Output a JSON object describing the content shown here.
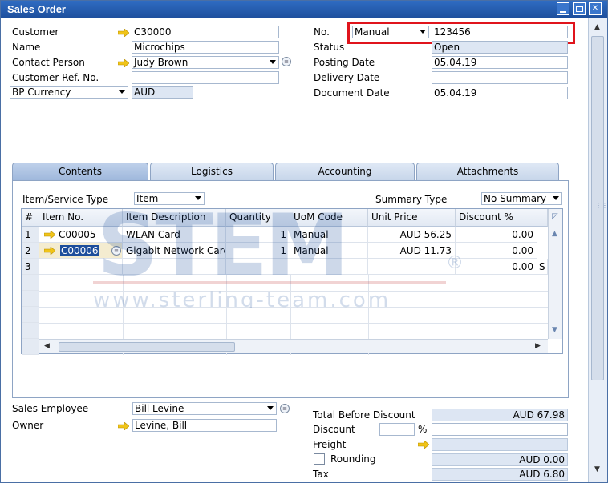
{
  "window": {
    "title": "Sales Order",
    "min_icon": "minimize-icon",
    "max_icon": "maximize-icon",
    "close_icon": "close-icon",
    "close_glyph": "✕"
  },
  "header_left": {
    "customer_label": "Customer",
    "customer_value": "C30000",
    "name_label": "Name",
    "name_value": "Microchips",
    "contact_label": "Contact Person",
    "contact_value": "Judy Brown",
    "custref_label": "Customer Ref. No.",
    "custref_value": "",
    "currency_label": "BP Currency",
    "currency_value": "AUD"
  },
  "header_right": {
    "no_label": "No.",
    "series_value": "Manual",
    "no_value": "123456",
    "status_label": "Status",
    "status_value": "Open",
    "posting_label": "Posting Date",
    "posting_value": "05.04.19",
    "delivery_label": "Delivery Date",
    "delivery_value": "",
    "docdate_label": "Document Date",
    "docdate_value": "05.04.19"
  },
  "tabs": [
    "Contents",
    "Logistics",
    "Accounting",
    "Attachments"
  ],
  "contents": {
    "itemtype_label": "Item/Service Type",
    "itemtype_value": "Item",
    "summary_label": "Summary Type",
    "summary_value": "No Summary"
  },
  "grid": {
    "headers": [
      "#",
      "Item No.",
      "Item Description",
      "Quantity",
      "UoM Code",
      "Unit Price",
      "Discount %"
    ],
    "rows": [
      {
        "n": "1",
        "item": "C00005",
        "desc": "WLAN Card",
        "qty": "1",
        "uom": "Manual",
        "price": "AUD 56.25",
        "disc": "0.00"
      },
      {
        "n": "2",
        "item": "C00006",
        "desc": "Gigabit Network Card",
        "qty": "1",
        "uom": "Manual",
        "price": "AUD 11.73",
        "disc": "0.00"
      },
      {
        "n": "3",
        "item": "",
        "desc": "",
        "qty": "",
        "uom": "",
        "price": "",
        "disc": "0.00"
      }
    ],
    "row3_extra": "S"
  },
  "footer_left": {
    "employee_label": "Sales Employee",
    "employee_value": "Bill Levine",
    "owner_label": "Owner",
    "owner_value": "Levine, Bill"
  },
  "footer_right": {
    "tbd_label": "Total Before Discount",
    "tbd_value": "AUD 67.98",
    "discount_label": "Discount",
    "discount_pct_sign": "%",
    "discount_value": "",
    "freight_label": "Freight",
    "freight_value": "",
    "rounding_label": "Rounding",
    "rounding_value": "AUD 0.00",
    "tax_label": "Tax",
    "tax_value": "AUD 6.80"
  },
  "watermark": {
    "big": "STEM",
    "url": "www.sterling-team.com",
    "reg": "®"
  }
}
